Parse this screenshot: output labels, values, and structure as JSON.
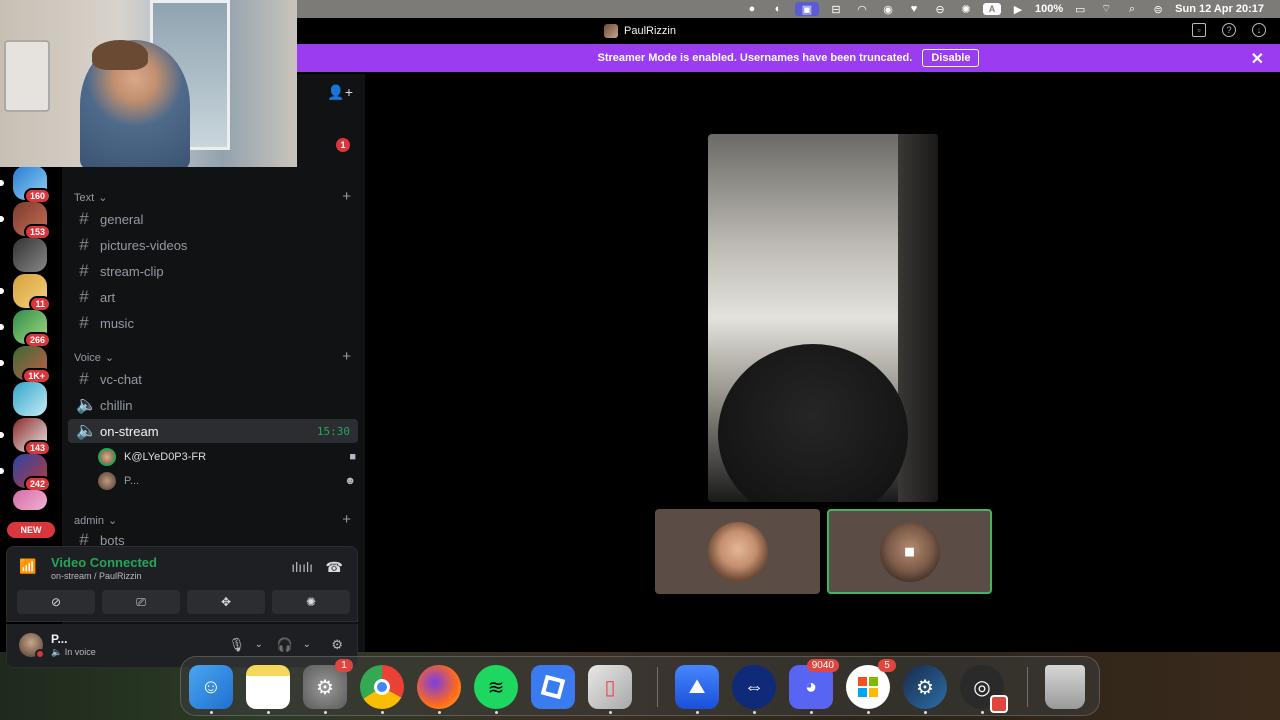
{
  "menubar": {
    "battery": "100%",
    "datetime": "Sun 12 Apr  20:17",
    "keyboard": "A",
    "icons": [
      "dot-icon",
      "screen-share-icon",
      "screen-capture-active-icon",
      "display-icon",
      "app-icon",
      "grammar-icon",
      "heart-icon",
      "vpn-icon",
      "globe-icon",
      "keyboard-input-icon",
      "play-icon",
      "battery-icon",
      "wifi-icon",
      "search-icon",
      "control-center-icon"
    ]
  },
  "window": {
    "title": "PaulRizzin"
  },
  "banner": {
    "text": "Streamer Mode is enabled. Usernames have been truncated.",
    "button": "Disable",
    "color": "#9b3cf0"
  },
  "servers": [
    {
      "badge": "160"
    },
    {
      "badge": "153"
    },
    {
      "badge": ""
    },
    {
      "badge": "11"
    },
    {
      "badge": "266"
    },
    {
      "badge": "1K+"
    },
    {
      "badge": ""
    },
    {
      "badge": "143"
    },
    {
      "badge": "242"
    }
  ],
  "new_badge": "NEW",
  "sidebar": {
    "top_badge": "1",
    "categories": {
      "text": "Text",
      "voice": "Voice",
      "admin": "admin"
    },
    "text_channels": [
      "general",
      "pictures-videos",
      "stream-clip",
      "art",
      "music"
    ],
    "voice_channels": {
      "vc_chat": "vc-chat",
      "chillin": "chillin",
      "on_stream": "on-stream",
      "timer": "15:30"
    },
    "voice_users": [
      {
        "name": "K@LYeD0P3-FR"
      },
      {
        "name": "P..."
      }
    ],
    "admin_channels": [
      "bots"
    ]
  },
  "voice_panel": {
    "status": "Video Connected",
    "channel": "on-stream / PaulRizzin",
    "status_color": "#23a55a"
  },
  "user_panel": {
    "name": "P...",
    "status": "In voice"
  },
  "dock": {
    "apps": [
      {
        "name": "Finder",
        "badge": ""
      },
      {
        "name": "Notes",
        "badge": ""
      },
      {
        "name": "System Settings",
        "badge": "1"
      },
      {
        "name": "Chrome",
        "badge": ""
      },
      {
        "name": "Firefox",
        "badge": ""
      },
      {
        "name": "Spotify",
        "badge": ""
      },
      {
        "name": "Roblox",
        "badge": ""
      },
      {
        "name": "iPhone Mirroring",
        "badge": ""
      },
      {
        "name": "NordVPN",
        "badge": ""
      },
      {
        "name": "TeamViewer",
        "badge": ""
      },
      {
        "name": "Discord",
        "badge": "9040"
      },
      {
        "name": "App Installer",
        "badge": "5"
      },
      {
        "name": "Steam",
        "badge": ""
      },
      {
        "name": "OBS",
        "badge": ""
      },
      {
        "name": "Trash",
        "badge": ""
      }
    ]
  }
}
